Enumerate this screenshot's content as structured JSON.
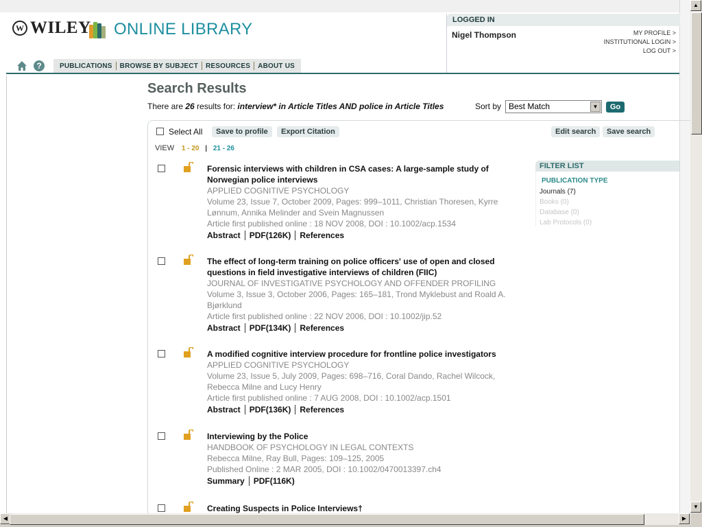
{
  "header": {
    "brand": "WILEY",
    "library_name": "ONLINE LIBRARY",
    "brand_color": "#1e8fa0"
  },
  "nav": {
    "tabs": [
      "PUBLICATIONS",
      "BROWSE BY SUBJECT",
      "RESOURCES",
      "ABOUT US"
    ],
    "icons": [
      "home-icon",
      "help-icon"
    ]
  },
  "login": {
    "heading": "LOGGED IN",
    "user": "Nigel Thompson",
    "links": [
      "MY PROFILE >",
      "INSTITUTIONAL LOGIN >",
      "LOG OUT >"
    ]
  },
  "search": {
    "title": "Search Results",
    "summary_prefix": "There are ",
    "count": "26",
    "summary_mid": " results for: ",
    "query": "interview* in Article Titles AND police in Article Titles",
    "sort_label": "Sort by",
    "sort_value": "Best Match",
    "go_label": "Go"
  },
  "toolbar": {
    "select_all": "Select All",
    "save_to_profile": "Save to profile",
    "export_citation": "Export Citation",
    "edit_search": "Edit search",
    "save_search": "Save search"
  },
  "view": {
    "label": "VIEW",
    "current": "1 - 20",
    "other": "21 - 26"
  },
  "results": [
    {
      "title": "Forensic interviews with children in CSA cases: A large-sample study of Norwegian police interviews",
      "journal": "APPLIED COGNITIVE PSYCHOLOGY",
      "details": "Volume 23, Issue 7, October 2009, Pages: 999–1011, Christian Thoresen, Kyrre Lønnum, Annika Melinder and Svein Magnussen",
      "published": "Article first published online : 18 NOV 2008, DOI : 10.1002/acp.1534",
      "links": [
        "Abstract",
        "PDF(126K)",
        "References"
      ]
    },
    {
      "title": "The effect of long-term training on police officers' use of open and closed questions in field investigative interviews of children (FIIC)",
      "journal": "JOURNAL OF INVESTIGATIVE PSYCHOLOGY AND OFFENDER PROFILING",
      "details": "Volume 3, Issue 3, October 2006, Pages: 165–181, Trond Myklebust and Roald A. Bjørklund",
      "published": "Article first published online : 22 NOV 2006, DOI : 10.1002/jip.52",
      "links": [
        "Abstract",
        "PDF(134K)",
        "References"
      ]
    },
    {
      "title": "A modified cognitive interview procedure for frontline police investigators",
      "journal": "APPLIED COGNITIVE PSYCHOLOGY",
      "details": "Volume 23, Issue 5, July 2009, Pages: 698–716, Coral Dando, Rachel Wilcock, Rebecca Milne and Lucy Henry",
      "published": "Article first published online : 7 AUG 2008, DOI : 10.1002/acp.1501",
      "links": [
        "Abstract",
        "PDF(136K)",
        "References"
      ]
    },
    {
      "title": "Interviewing by the Police",
      "journal": "HANDBOOK OF PSYCHOLOGY IN LEGAL CONTEXTS",
      "details": "Rebecca Milne, Ray Bull, Pages: 109–125, 2005",
      "published": "Published Online : 2 MAR 2005, DOI : 10.1002/0470013397.ch4",
      "links": [
        "Summary",
        "PDF(116K)"
      ]
    },
    {
      "title": "Creating Suspects in Police Interviews†",
      "journal": "",
      "details": "",
      "published": "",
      "links": []
    }
  ],
  "filter": {
    "heading": "FILTER LIST",
    "type_heading": "PUBLICATION TYPE",
    "items": [
      "Journals (7)",
      "Books (0)",
      "Database (0)",
      "Lab Protocols (0)"
    ]
  }
}
